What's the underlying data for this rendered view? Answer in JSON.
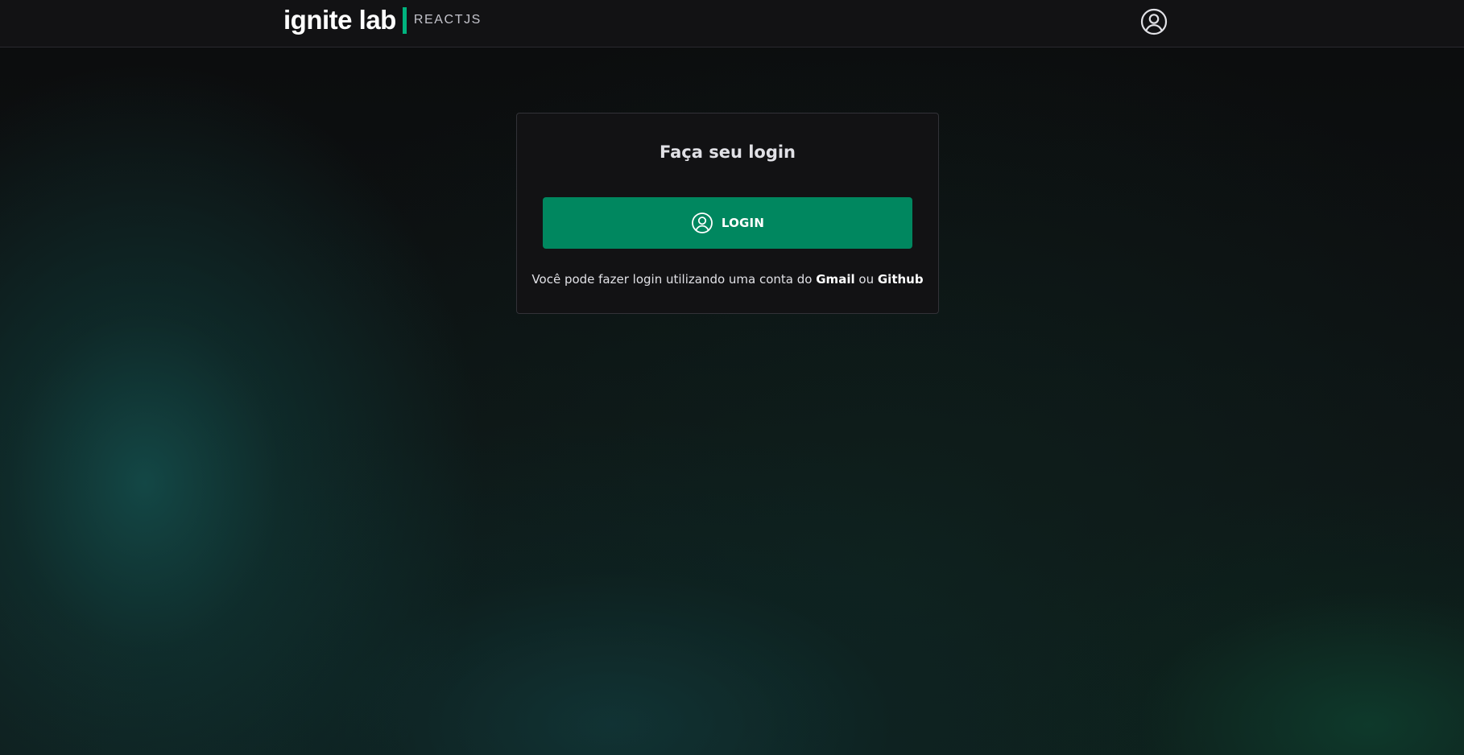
{
  "header": {
    "logo_main": "ignite lab",
    "logo_sub": "REACTJS",
    "accent_color": "#00b37e",
    "avatar_icon": "user-circle-icon"
  },
  "login_card": {
    "title": "Faça seu login",
    "button_label": "LOGIN",
    "button_icon": "user-circle-icon",
    "button_color": "#00875f",
    "help_prefix": "Você pode fazer login utilizando uma conta do",
    "help_provider_1": "Gmail",
    "help_joiner": "ou",
    "help_provider_2": "Github"
  }
}
